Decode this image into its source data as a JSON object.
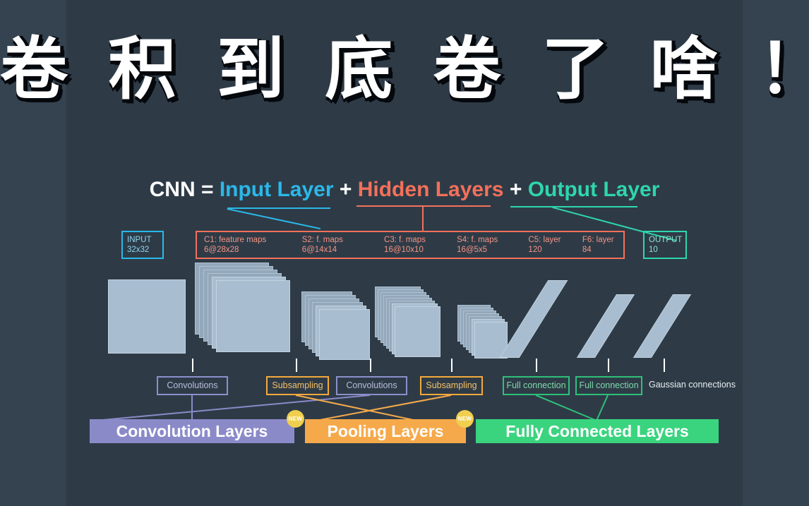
{
  "headline": {
    "text": "卷 积 到 底 卷 了 啥 ！"
  },
  "formula": {
    "cnn": "CNN =",
    "input_layer": "Input Layer",
    "plus1": "+",
    "hidden_layers": "Hidden Layers",
    "plus2": "+",
    "output_layer": "Output Layer"
  },
  "spec_boxes": {
    "input": {
      "line1": "INPUT",
      "line2": "32x32"
    },
    "output": {
      "line1": "OUTPUT",
      "line2": "10"
    },
    "hidden": [
      {
        "line1": "C1:  feature maps",
        "line2": "6@28x28"
      },
      {
        "line1": "S2:  f. maps",
        "line2": "6@14x14"
      },
      {
        "line1": "C3:  f. maps",
        "line2": "16@10x10"
      },
      {
        "line1": "S4:  f. maps",
        "line2": "16@5x5"
      },
      {
        "line1": "C5:  layer",
        "line2": "120"
      },
      {
        "line1": "F6:  layer",
        "line2": "84"
      }
    ]
  },
  "operations": [
    {
      "label": "Convolutions",
      "kind": "conv"
    },
    {
      "label": "Subsampling",
      "kind": "sub"
    },
    {
      "label": "Convolutions",
      "kind": "conv"
    },
    {
      "label": "Subsampling",
      "kind": "sub"
    },
    {
      "label": "Full connection",
      "kind": "full"
    },
    {
      "label": "Full connection",
      "kind": "full"
    },
    {
      "label": "Gaussian connections",
      "kind": "plain"
    }
  ],
  "summary_bars": [
    {
      "label": "Convolution Layers",
      "kind": "conv"
    },
    {
      "label": "Pooling Layers",
      "kind": "pool"
    },
    {
      "label": "Fully Connected Layers",
      "kind": "fc"
    }
  ],
  "badges": [
    {
      "text": "NEW"
    },
    {
      "text": "NEW"
    }
  ],
  "colors": {
    "background": "#2e3b47",
    "band": "#354350",
    "input_accent": "#2bb8e8",
    "hidden_accent": "#f4705a",
    "output_accent": "#2fd6ab",
    "conv_accent": "#8b8ac9",
    "pool_accent": "#f6a94a",
    "fc_accent": "#3ad47f",
    "sheet": "#a8bdd0",
    "badge": "#f0cf4e"
  }
}
